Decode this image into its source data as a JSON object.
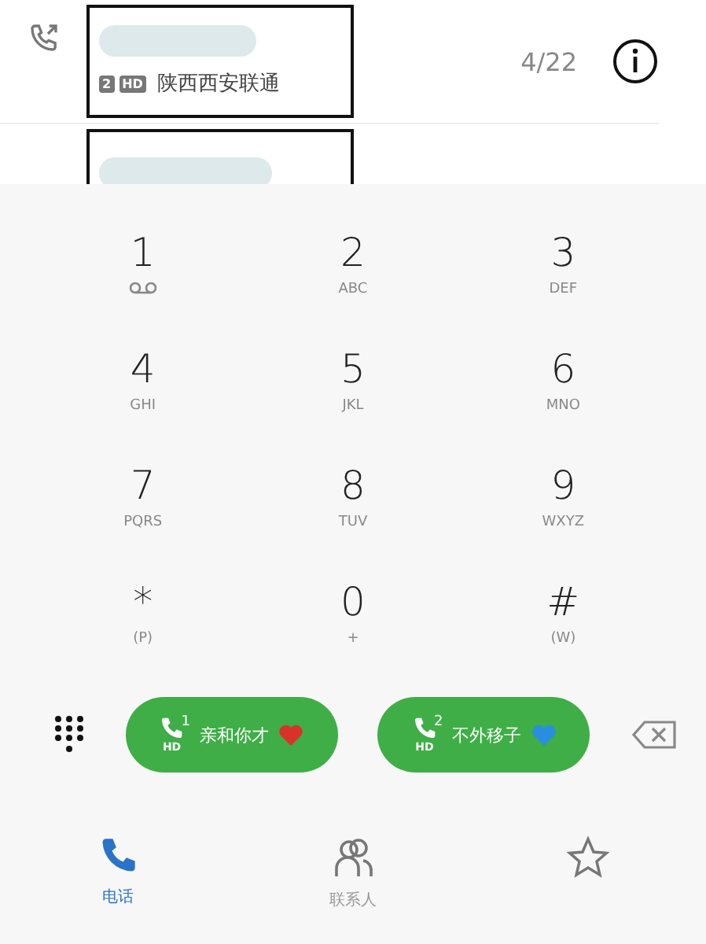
{
  "recent_calls": [
    {
      "kind": "full",
      "sim": "2",
      "hd": "HD",
      "location": "陕西西安联通",
      "date": "4/22"
    },
    {
      "kind": "partial"
    }
  ],
  "keys": [
    {
      "digit": "1",
      "kind": "voicemail"
    },
    {
      "digit": "2",
      "kind": "letters",
      "letters": "ABC"
    },
    {
      "digit": "3",
      "kind": "letters",
      "letters": "DEF"
    },
    {
      "digit": "4",
      "kind": "letters",
      "letters": "GHI"
    },
    {
      "digit": "5",
      "kind": "letters",
      "letters": "JKL"
    },
    {
      "digit": "6",
      "kind": "letters",
      "letters": "MNO"
    },
    {
      "digit": "7",
      "kind": "letters",
      "letters": "PQRS"
    },
    {
      "digit": "8",
      "kind": "letters",
      "letters": "TUV"
    },
    {
      "digit": "9",
      "kind": "letters",
      "letters": "WXYZ"
    },
    {
      "digit": "*",
      "kind": "letters",
      "letters": "(P)"
    },
    {
      "digit": "0",
      "kind": "letters",
      "letters": "+"
    },
    {
      "digit": "#",
      "kind": "letters",
      "letters": "(W)"
    }
  ],
  "call_buttons": [
    {
      "sim": "1",
      "hd": "HD",
      "label": "亲和你才",
      "color": "#d9322b"
    },
    {
      "sim": "2",
      "hd": "HD",
      "label": "不外移子",
      "color": "#2a8ee0"
    }
  ],
  "tabs": [
    {
      "kind": "phone",
      "label": "电话",
      "selected": true
    },
    {
      "kind": "contacts",
      "label": "联系人",
      "selected": false
    },
    {
      "kind": "favorites",
      "selected": false
    }
  ]
}
